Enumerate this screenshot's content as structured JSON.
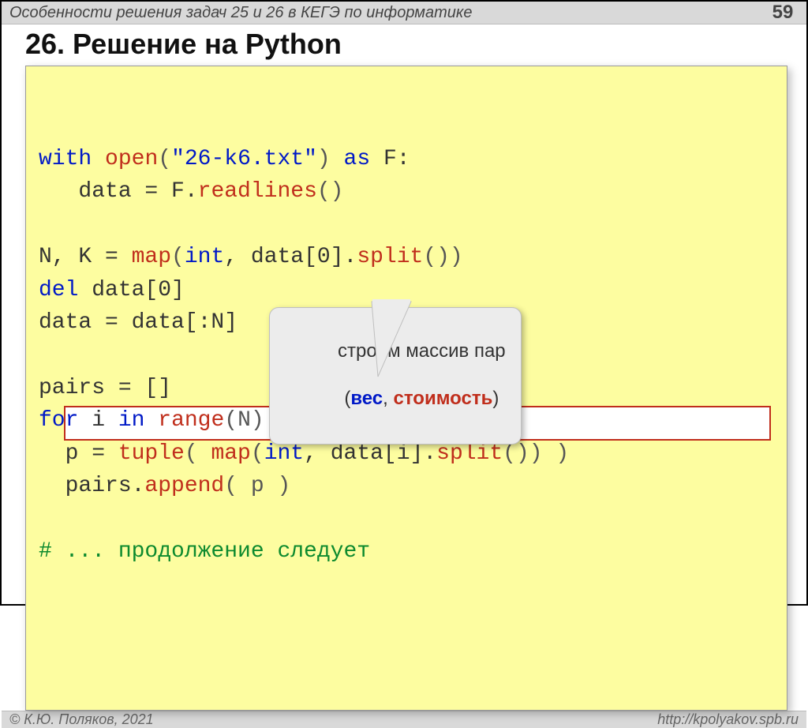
{
  "header": {
    "title": "Особенности решения задач 25 и 26 в КЕГЭ по информатике",
    "page": "59"
  },
  "slide": {
    "title": "26. Решение на Python"
  },
  "code": {
    "l1_with": "with",
    "l1_open": "open",
    "l1_p1": "(",
    "l1_str": "\"26-k6.txt\"",
    "l1_p2": ")",
    "l1_as": "as",
    "l1_f": "F:",
    "l2_indent": "   data = F.",
    "l2_fn": "readlines",
    "l2_p": "()",
    "l4_a": "N, K = ",
    "l4_map": "map",
    "l4_p1": "(",
    "l4_int": "int",
    "l4_mid": ", data[0].",
    "l4_split": "split",
    "l4_p2": "())",
    "l5_del": "del",
    "l5_rest": " data[0]",
    "l6": "data = data[:N]",
    "l8": "pairs = []",
    "l9_for": "for",
    "l9_mid": " i ",
    "l9_in": "in",
    "l9_sp": " ",
    "l9_range": "range",
    "l9_p": "(N):",
    "l10_pre": "  p = ",
    "l10_tuple": "tuple",
    "l10_p1": "( ",
    "l10_map": "map",
    "l10_p2": "(",
    "l10_int": "int",
    "l10_mid": ", data[i].",
    "l10_split": "split",
    "l10_p3": "()) )",
    "l11_pre": "  pairs.",
    "l11_fn": "append",
    "l11_p": "( p )",
    "l13": "# ... продолжение следует"
  },
  "callout": {
    "line1": "строим массив пар",
    "p_open": "(",
    "w1": "вес",
    "sep": ", ",
    "w2": "стоимость",
    "p_close": ")"
  },
  "footer": {
    "left": "© К.Ю. Поляков, 2021",
    "right": "http://kpolyakov.spb.ru"
  }
}
